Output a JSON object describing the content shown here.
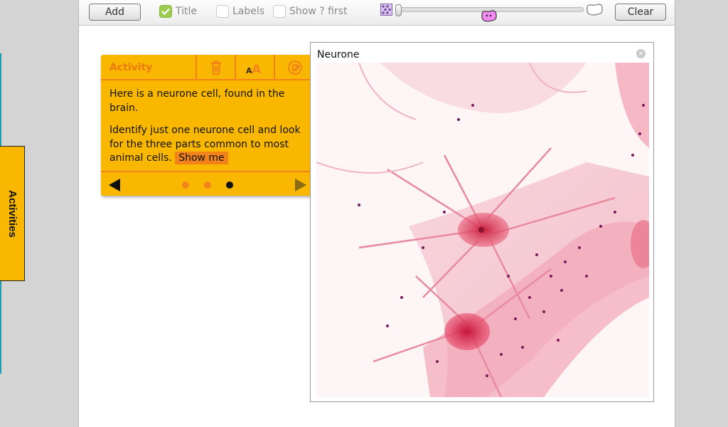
{
  "sidebar": {
    "activities_label": "Activities"
  },
  "toolbar": {
    "add_label": "Add",
    "title_checkbox": {
      "label": "Title",
      "checked": true
    },
    "labels_checkbox": {
      "label": "Labels",
      "checked": false
    },
    "show_first_checkbox": {
      "label": "Show ? first",
      "checked": false
    },
    "clear_label": "Clear",
    "icons": [
      "pattern-icon",
      "cell-icon",
      "cell-outline-icon"
    ]
  },
  "activity": {
    "title": "Activity",
    "paragraph1": "Here is a neurone cell, found in the brain.",
    "paragraph2": "Identify just one neurone cell and look for the three parts common to most animal cells.",
    "show_me_label": "Show me",
    "pages_total": 3,
    "current_page": 3,
    "icons": [
      "trash-icon",
      "text-size-icon",
      "zoom-icon",
      "prev-arrow-icon",
      "next-arrow-icon"
    ]
  },
  "image_panel": {
    "title": "Neurone",
    "close_label": "×"
  },
  "colors": {
    "accent": "#f9b700",
    "accent_dark": "#f2831a",
    "checkbox_on": "#9ccc50",
    "cell_pink": "#e23a5a"
  }
}
